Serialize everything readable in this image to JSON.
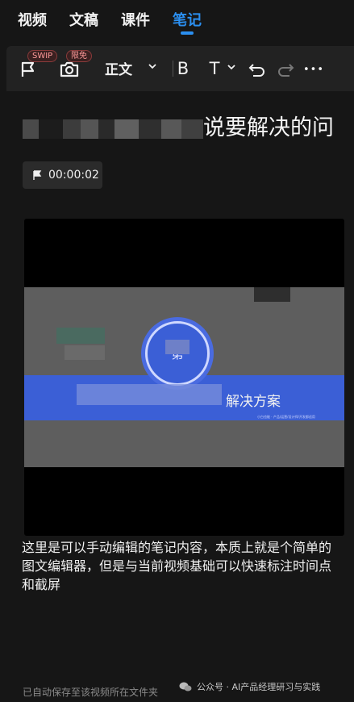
{
  "tabs": [
    {
      "label": "视频",
      "active": false
    },
    {
      "label": "文稿",
      "active": false
    },
    {
      "label": "课件",
      "active": false
    },
    {
      "label": "笔记",
      "active": true
    }
  ],
  "toolbar": {
    "flag_badge": "SWIP",
    "camera_badge": "限免",
    "font_style": "正文",
    "bold_label": "B",
    "text_label": "T",
    "more_label": "•••"
  },
  "note": {
    "title_visible": "说要解决的问",
    "timestamp": "00:00:02",
    "body": "这里是可以手动编辑的笔记内容，本质上就是个简单的图文编辑器，但是与当前视频基础可以快速标注时间点和截屏"
  },
  "screenshot": {
    "circle_text": "第",
    "band_text": "解决方案",
    "band_small_text": "小白也能 · 产品/运营/设计师/开发都适用"
  },
  "footer": {
    "autosave": "已自动保存至该视频所在文件夹",
    "watermark": "公众号 · AI产品经理研习与实践"
  },
  "colors": {
    "accent": "#2b8ff0",
    "background": "#161616",
    "toolbar": "#222222",
    "slide_blue": "#3b5fd6"
  }
}
